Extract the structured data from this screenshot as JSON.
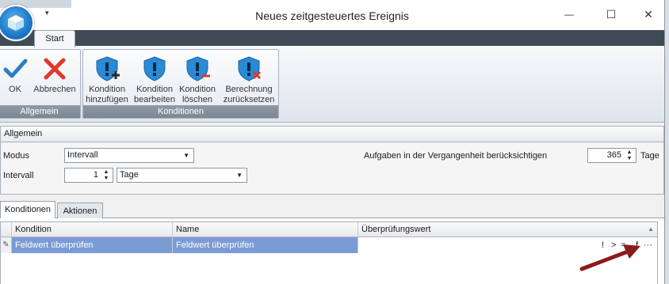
{
  "window": {
    "title": "Neues zeitgesteuertes Ereignis",
    "qat_arrow": "▾",
    "controls": {
      "minimize": "—",
      "maximize": "☐",
      "close": "✕"
    }
  },
  "ribbon": {
    "tab": "Start",
    "groups": {
      "allgemein": {
        "label": "Allgemein",
        "ok": "OK",
        "abbrechen": "Abbrechen"
      },
      "konditionen": {
        "label": "Konditionen",
        "hinzufuegen": [
          "Kondition",
          "hinzufügen"
        ],
        "bearbeiten": [
          "Kondition",
          "bearbeiten"
        ],
        "loeschen": [
          "Kondition",
          "löschen"
        ],
        "zuruecksetzen": [
          "Berechnung",
          "zurücksetzen"
        ]
      }
    }
  },
  "allgemein": {
    "header": "Allgemein",
    "modus_label": "Modus",
    "modus_value": "Intervall",
    "intervall_label": "Intervall",
    "intervall_value": "1",
    "intervall_unit": "Tage",
    "vergangenheit_label": "Aufgaben in der Vergangenheit berücksichtigen",
    "vergangenheit_value": "365",
    "vergangenheit_unit": "Tage"
  },
  "tabs": {
    "konditionen": "Konditionen",
    "aktionen": "Aktionen"
  },
  "grid": {
    "columns": [
      "Kondition",
      "Name",
      "Überprüfungswert"
    ],
    "rows": [
      {
        "kondition": "Feldwert überprüfen",
        "name": "Feldwert überprüfen",
        "wert": ""
      }
    ],
    "row_tools": {
      "not": "!",
      "gt": ">",
      "eq": "=",
      "f": "f",
      "more": "···"
    }
  },
  "colors": {
    "brand_orb": "#1b78c6",
    "selection": "#7b9bd4",
    "annotation_arrow": "#8b1a1a",
    "ok_check": "#2f7fc0",
    "cancel_x": "#e0392b"
  }
}
